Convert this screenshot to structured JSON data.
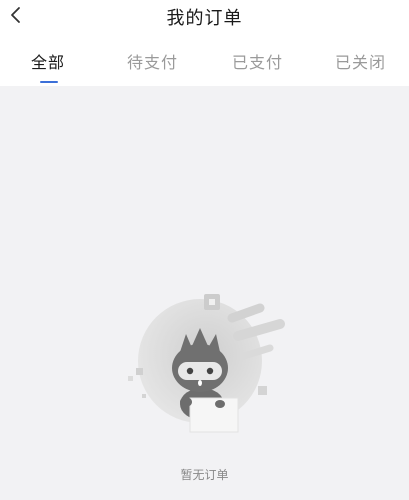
{
  "header": {
    "back_icon": "chevron-left-icon",
    "title": "我的订单"
  },
  "tabs": [
    {
      "label": "全部",
      "active": true
    },
    {
      "label": "待支付",
      "active": false
    },
    {
      "label": "已支付",
      "active": false
    },
    {
      "label": "已关闭",
      "active": false
    }
  ],
  "empty_state": {
    "illustration_icon": "empty-orders-mascot-icon",
    "message": "暂无订单"
  },
  "colors": {
    "accent": "#3b6fd8",
    "background": "#f2f2f4",
    "active_tab_text": "#1a1a1a",
    "inactive_tab_text": "#9a9a9a"
  }
}
